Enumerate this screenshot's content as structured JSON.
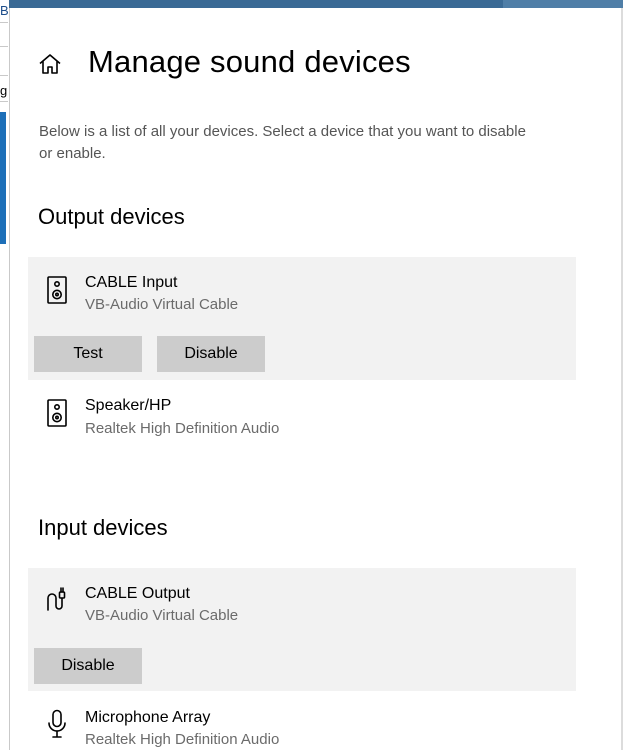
{
  "background_window": {
    "fragments": [
      "B",
      "g"
    ]
  },
  "header": {
    "home_icon": "home-icon",
    "title": "Manage sound devices"
  },
  "description": "Below is a list of all your devices. Select a device that you want to disable or enable.",
  "output_section": {
    "heading": "Output devices",
    "devices": [
      {
        "icon": "speaker-icon",
        "name": "CABLE Input",
        "driver": "VB-Audio Virtual Cable",
        "selected": true,
        "buttons": [
          "Test",
          "Disable"
        ]
      },
      {
        "icon": "speaker-icon",
        "name": "Speaker/HP",
        "driver": "Realtek High Definition Audio",
        "selected": false
      }
    ]
  },
  "input_section": {
    "heading": "Input devices",
    "devices": [
      {
        "icon": "audio-cable-icon",
        "name": "CABLE Output",
        "driver": "VB-Audio Virtual Cable",
        "selected": true,
        "buttons": [
          "Disable"
        ]
      },
      {
        "icon": "microphone-icon",
        "name": "Microphone Array",
        "driver": "Realtek High Definition Audio",
        "selected": false
      }
    ]
  },
  "colors": {
    "selected_card_bg": "#f2f2f2",
    "button_bg": "#cccccc",
    "secondary_text": "#6b6b6b",
    "titlebar": "#3a6a95"
  }
}
